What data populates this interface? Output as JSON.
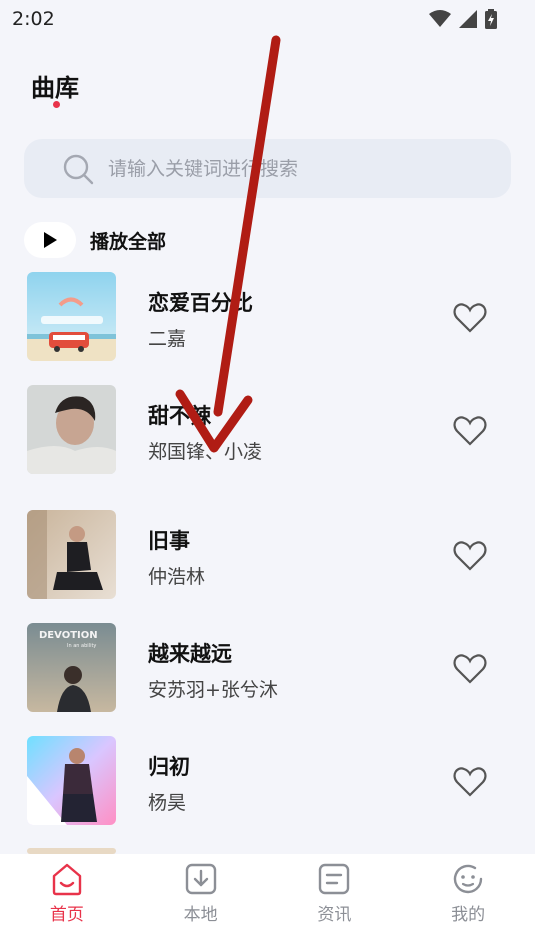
{
  "status_bar": {
    "time": "2:02"
  },
  "header": {
    "title": "曲库"
  },
  "search": {
    "placeholder": "请输入关键词进行搜索"
  },
  "play_all": {
    "label": "播放全部"
  },
  "songs": [
    {
      "title": "恋爱百分比",
      "artist": "二嘉",
      "liked": false
    },
    {
      "title": "甜不辣",
      "artist": "郑国锋、小凌",
      "liked": false
    },
    {
      "title": "旧事",
      "artist": "仲浩林",
      "liked": false
    },
    {
      "title": "越来越远",
      "artist": "安苏羽+张兮沐",
      "liked": false
    },
    {
      "title": "归初",
      "artist": "杨昊",
      "liked": false
    }
  ],
  "covers": {
    "cover_4_text": "DEVOTION",
    "cover_4_subtext": "In an ability"
  },
  "nav": [
    {
      "label": "首页",
      "icon": "home-icon",
      "active": true
    },
    {
      "label": "本地",
      "icon": "download-icon",
      "active": false
    },
    {
      "label": "资讯",
      "icon": "news-icon",
      "active": false
    },
    {
      "label": "我的",
      "icon": "profile-icon",
      "active": false
    }
  ],
  "colors": {
    "accent": "#e8334a",
    "background": "#f4f5fa",
    "annotation_arrow": "#b01c14"
  }
}
